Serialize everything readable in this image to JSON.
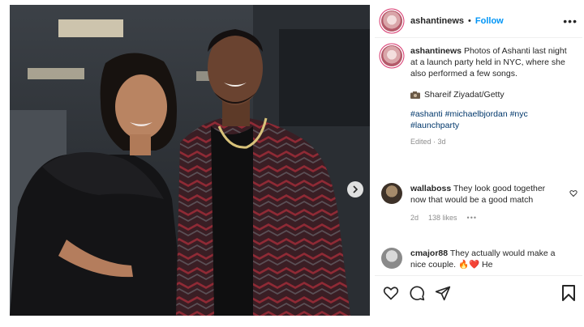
{
  "post": {
    "username": "ashantinews",
    "separator": "•",
    "follow_label": "Follow",
    "more_label": "•••"
  },
  "caption": {
    "username": "ashantinews",
    "text": "Photos of Ashanti last night at a launch party held in NYC, where she also performed a few songs.",
    "credit": "Shareif Ziyadat/Getty",
    "hashtags": "#ashanti #michaelbjordan #nyc #launchparty",
    "edited": "Edited · 3d"
  },
  "comments": [
    {
      "username": "wallaboss",
      "text": "They look good together now that would be a good match",
      "age": "2d",
      "likes": "138 likes",
      "more": "•••"
    },
    {
      "username": "cmajor88",
      "text": "They actually would make a nice couple. 🔥❤️ He"
    }
  ],
  "icons": {
    "like": "heart-icon",
    "comment": "comment-icon",
    "share": "share-icon",
    "save": "bookmark-icon",
    "next": "chevron-right-icon",
    "photo_credit": "camera-icon"
  },
  "colors": {
    "link": "#0095f6",
    "hashtag": "#00376b",
    "muted": "#8e8e8e",
    "text": "#262626"
  }
}
